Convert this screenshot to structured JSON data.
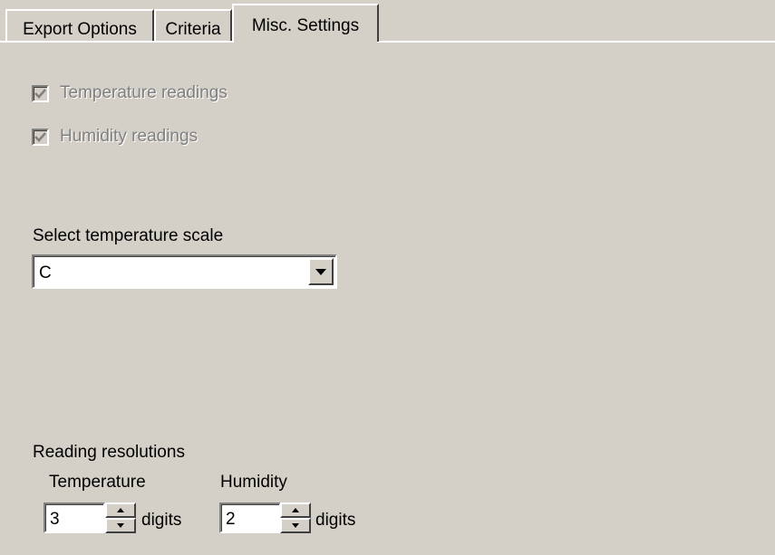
{
  "tabs": [
    {
      "label": "Export Options",
      "active": false
    },
    {
      "label": "Criteria",
      "active": false
    },
    {
      "label": "Misc. Settings",
      "active": true
    }
  ],
  "checkboxes": {
    "temperature": {
      "label": "Temperature readings",
      "checked": true,
      "enabled": false
    },
    "humidity": {
      "label": "Humidity readings",
      "checked": true,
      "enabled": false
    }
  },
  "scale": {
    "label": "Select temperature scale",
    "value": "C"
  },
  "resolutions": {
    "label": "Reading resolutions",
    "temperature": {
      "label": "Temperature",
      "value": "3",
      "unit": "digits"
    },
    "humidity": {
      "label": "Humidity",
      "value": "2",
      "unit": "digits"
    }
  },
  "colors": {
    "background": "#d4d0c8",
    "disabled_text": "#808080"
  },
  "icons": {
    "checkmark": "check-icon",
    "dropdown": "triangle-down-icon",
    "spin_up": "triangle-up-icon",
    "spin_down": "triangle-down-icon"
  }
}
